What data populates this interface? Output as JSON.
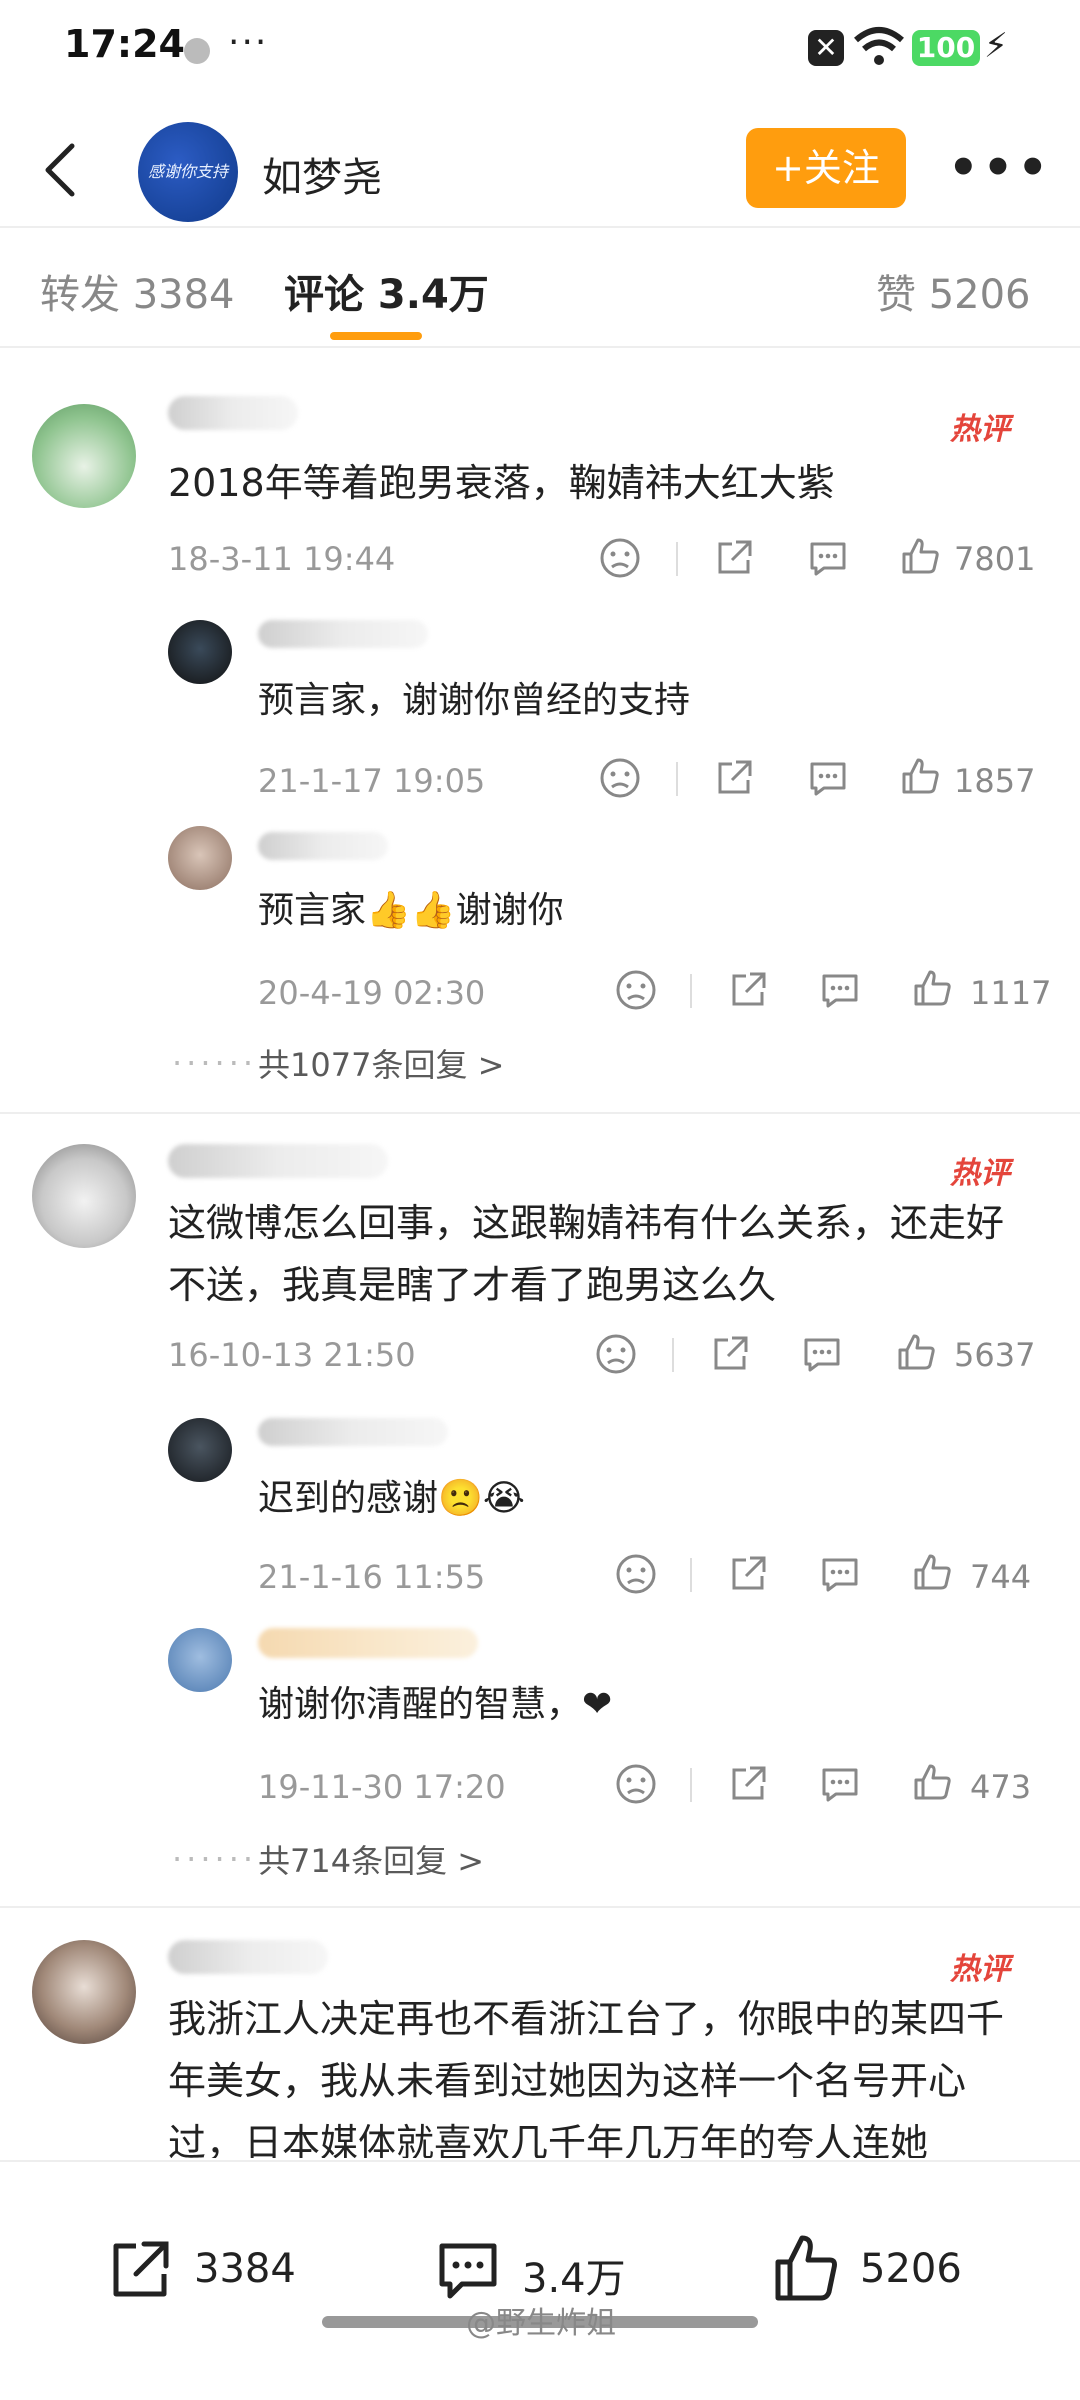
{
  "status_bar": {
    "time": "17:24",
    "more": "···",
    "battery": "100"
  },
  "header": {
    "name": "如梦尧",
    "avatar_text": "感谢你支持",
    "follow_label": "+关注",
    "more": "•••"
  },
  "tabs": [
    {
      "label": "转发 3384"
    },
    {
      "label": "评论 3.4万"
    },
    {
      "label": "赞 5206"
    }
  ],
  "comments": [
    {
      "hot": "热评",
      "text": "2018年等着跑男衰落，鞠婧祎大红大紫",
      "time": "18-3-11 19:44",
      "likes": "7801",
      "replies": [
        {
          "text": "预言家，谢谢你曾经的支持",
          "time": "21-1-17 19:05",
          "likes": "1857"
        },
        {
          "text": "预言家👍👍谢谢你",
          "time": "20-4-19 02:30",
          "likes": "1117"
        }
      ],
      "more_replies": "共1077条回复 >"
    },
    {
      "hot": "热评",
      "text": "这微博怎么回事，这跟鞠婧祎有什么关系，还走好不送，我真是瞎了才看了跑男这么久",
      "time": "16-10-13 21:50",
      "likes": "5637",
      "replies": [
        {
          "text": "迟到的感谢🙁😭",
          "time": "21-1-16 11:55",
          "likes": "744"
        },
        {
          "text": "谢谢你清醒的智慧，❤",
          "time": "19-11-30 17:20",
          "likes": "473"
        }
      ],
      "more_replies": "共714条回复 >"
    },
    {
      "hot": "热评",
      "text": "我浙江人决定再也不看浙江台了，你眼中的某四千年美女，我从未看到过她因为这样一个名号开心过，日本媒体就喜欢几千年几万年的夸人连她"
    }
  ],
  "bottom_bar": {
    "repost": "3384",
    "comment": "3.4万",
    "like": "5206"
  },
  "watermark": "@野生炸姐",
  "colors": {
    "accent": "#ff9d0e",
    "hot": "#e4453b",
    "battery": "#4cd964"
  }
}
